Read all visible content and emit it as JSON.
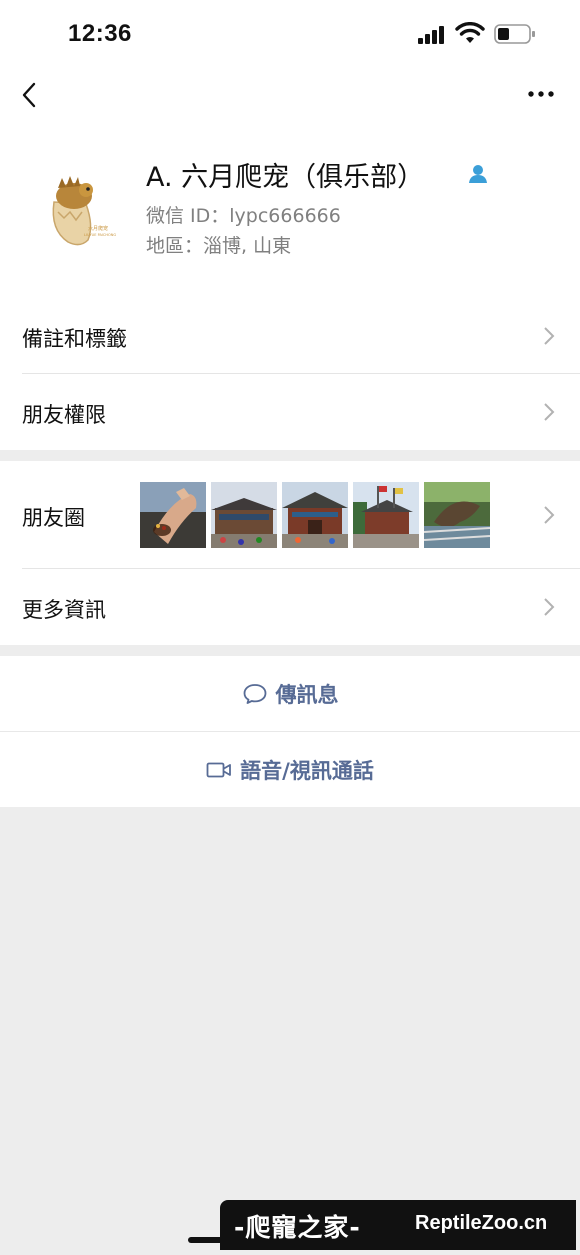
{
  "status_bar": {
    "time": "12:36"
  },
  "profile": {
    "name": "A. 六月爬宠（俱乐部）",
    "wechat_id": "微信 ID：lypc666666",
    "region": "地區：淄博, 山東"
  },
  "settings": {
    "remarks_tags": "備註和標籤",
    "friend_permissions": "朋友權限"
  },
  "info": {
    "moments": "朋友圈",
    "more_info": "更多資訊"
  },
  "actions": {
    "send_message": "傳訊息",
    "voice_video_call": "語音/視訊通話"
  },
  "watermark": {
    "cn": "-爬寵之家-",
    "en": "ReptileZoo.cn"
  },
  "colors": {
    "link": "#576b95",
    "badge": "#3b9fd8",
    "background": "#ededed"
  }
}
